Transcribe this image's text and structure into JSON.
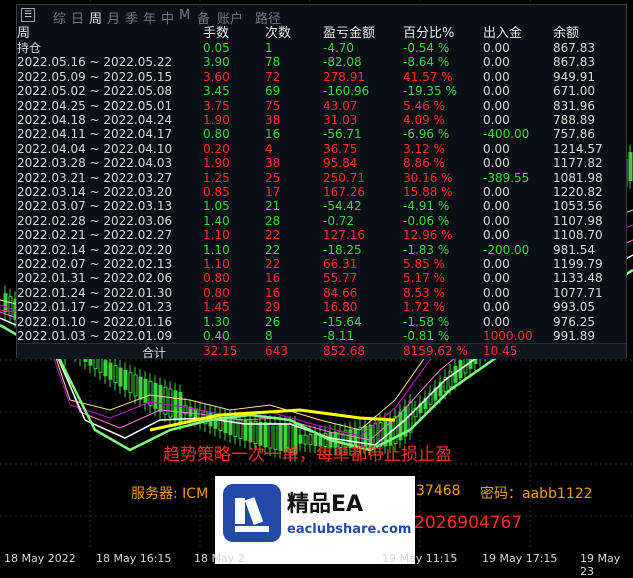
{
  "tabs": [
    "综",
    "日",
    "周",
    "月",
    "季",
    "年",
    "中",
    "M",
    "备",
    "账户",
    "路径"
  ],
  "active_tab": "周",
  "columns": [
    "周",
    "手数",
    "次数",
    "盈亏金额",
    "百分比%",
    "出入金",
    "余额"
  ],
  "rows": [
    {
      "period": "持仓",
      "lots": "0.05",
      "count": "1",
      "pnl": "-4.70",
      "pct": "-0.54 %",
      "flow": "0.00",
      "bal": "867.83",
      "c": "g",
      "fc": "w"
    },
    {
      "period": "2022.05.16 ~ 2022.05.22",
      "lots": "3.90",
      "count": "78",
      "pnl": "-82.08",
      "pct": "-8.64 %",
      "flow": "0.00",
      "bal": "867.83",
      "c": "g",
      "fc": "w"
    },
    {
      "period": "2022.05.09 ~ 2022.05.15",
      "lots": "3.60",
      "count": "72",
      "pnl": "278.91",
      "pct": "41.57 %",
      "flow": "0.00",
      "bal": "949.91",
      "c": "r",
      "fc": "w"
    },
    {
      "period": "2022.05.02 ~ 2022.05.08",
      "lots": "3.45",
      "count": "69",
      "pnl": "-160.96",
      "pct": "-19.35 %",
      "flow": "0.00",
      "bal": "671.00",
      "c": "g",
      "fc": "w"
    },
    {
      "period": "2022.04.25 ~ 2022.05.01",
      "lots": "3.75",
      "count": "75",
      "pnl": "43.07",
      "pct": "5.46 %",
      "flow": "0.00",
      "bal": "831.96",
      "c": "r",
      "fc": "w"
    },
    {
      "period": "2022.04.18 ~ 2022.04.24",
      "lots": "1.90",
      "count": "38",
      "pnl": "31.03",
      "pct": "4.09 %",
      "flow": "0.00",
      "bal": "788.89",
      "c": "r",
      "fc": "w"
    },
    {
      "period": "2022.04.11 ~ 2022.04.17",
      "lots": "0.80",
      "count": "16",
      "pnl": "-56.71",
      "pct": "-6.96 %",
      "flow": "-400.00",
      "bal": "757.86",
      "c": "g",
      "fc": "g"
    },
    {
      "period": "2022.04.04 ~ 2022.04.10",
      "lots": "0.20",
      "count": "4",
      "pnl": "36.75",
      "pct": "3.12 %",
      "flow": "0.00",
      "bal": "1214.57",
      "c": "r",
      "fc": "w"
    },
    {
      "period": "2022.03.28 ~ 2022.04.03",
      "lots": "1.90",
      "count": "38",
      "pnl": "95.84",
      "pct": "8.86 %",
      "flow": "0.00",
      "bal": "1177.82",
      "c": "r",
      "fc": "w"
    },
    {
      "period": "2022.03.21 ~ 2022.03.27",
      "lots": "1.25",
      "count": "25",
      "pnl": "250.71",
      "pct": "30.16 %",
      "flow": "-389.55",
      "bal": "1081.98",
      "c": "r",
      "fc": "g"
    },
    {
      "period": "2022.03.14 ~ 2022.03.20",
      "lots": "0.85",
      "count": "17",
      "pnl": "167.26",
      "pct": "15.88 %",
      "flow": "0.00",
      "bal": "1220.82",
      "c": "r",
      "fc": "w"
    },
    {
      "period": "2022.03.07 ~ 2022.03.13",
      "lots": "1.05",
      "count": "21",
      "pnl": "-54.42",
      "pct": "-4.91 %",
      "flow": "0.00",
      "bal": "1053.56",
      "c": "g",
      "fc": "w"
    },
    {
      "period": "2022.02.28 ~ 2022.03.06",
      "lots": "1.40",
      "count": "28",
      "pnl": "-0.72",
      "pct": "-0.06 %",
      "flow": "0.00",
      "bal": "1107.98",
      "c": "g",
      "fc": "w"
    },
    {
      "period": "2022.02.21 ~ 2022.02.27",
      "lots": "1.10",
      "count": "22",
      "pnl": "127.16",
      "pct": "12.96 %",
      "flow": "0.00",
      "bal": "1108.70",
      "c": "r",
      "fc": "w"
    },
    {
      "period": "2022.02.14 ~ 2022.02.20",
      "lots": "1.10",
      "count": "22",
      "pnl": "-18.25",
      "pct": "-1.83 %",
      "flow": "-200.00",
      "bal": "981.54",
      "c": "g",
      "fc": "g"
    },
    {
      "period": "2022.02.07 ~ 2022.02.13",
      "lots": "1.10",
      "count": "22",
      "pnl": "66.31",
      "pct": "5.85 %",
      "flow": "0.00",
      "bal": "1199.79",
      "c": "r",
      "fc": "w"
    },
    {
      "period": "2022.01.31 ~ 2022.02.06",
      "lots": "0.80",
      "count": "16",
      "pnl": "55.77",
      "pct": "5.17 %",
      "flow": "0.00",
      "bal": "1133.48",
      "c": "r",
      "fc": "w"
    },
    {
      "period": "2022.01.24 ~ 2022.01.30",
      "lots": "0.80",
      "count": "16",
      "pnl": "84.66",
      "pct": "8.53 %",
      "flow": "0.00",
      "bal": "1077.71",
      "c": "r",
      "fc": "w"
    },
    {
      "period": "2022.01.17 ~ 2022.01.23",
      "lots": "1.45",
      "count": "29",
      "pnl": "16.80",
      "pct": "1.72 %",
      "flow": "0.00",
      "bal": "993.05",
      "c": "r",
      "fc": "w"
    },
    {
      "period": "2022.01.10 ~ 2022.01.16",
      "lots": "1.30",
      "count": "26",
      "pnl": "-15.64",
      "pct": "-1.58 %",
      "flow": "0.00",
      "bal": "976.25",
      "c": "g",
      "fc": "w"
    },
    {
      "period": "2022.01.03 ~ 2022.01.09",
      "lots": "0.40",
      "count": "8",
      "pnl": "-8.11",
      "pct": "-0.81 %",
      "flow": "1000.00",
      "bal": "991.89",
      "c": "g",
      "fc": "r"
    }
  ],
  "total": {
    "label": "合计",
    "lots": "32.15",
    "count": "643",
    "pnl": "852.68",
    "pct": "8159.62 %",
    "flow": "10.45"
  },
  "time_axis": [
    "18 May 2022",
    "18 May 16:15",
    "18 May 2",
    "19 May 11:15",
    "19 May 17:15",
    "19 May 23"
  ],
  "overlay": {
    "strategy": "趋势策略一次一单，每单都带止损止盈",
    "server_label": "服务器: ICM",
    "account_fragment": "37468",
    "password": "密码：aabb1122",
    "phone": "2026904767"
  },
  "watermark": {
    "title": "精品EA",
    "site": "eaclubshare.com"
  },
  "colors": {
    "profit": "#ff2a2a",
    "loss": "#3fd13f",
    "neutral": "#d8d8d8",
    "accent": "#f0a000",
    "brand": "#234aa8"
  }
}
